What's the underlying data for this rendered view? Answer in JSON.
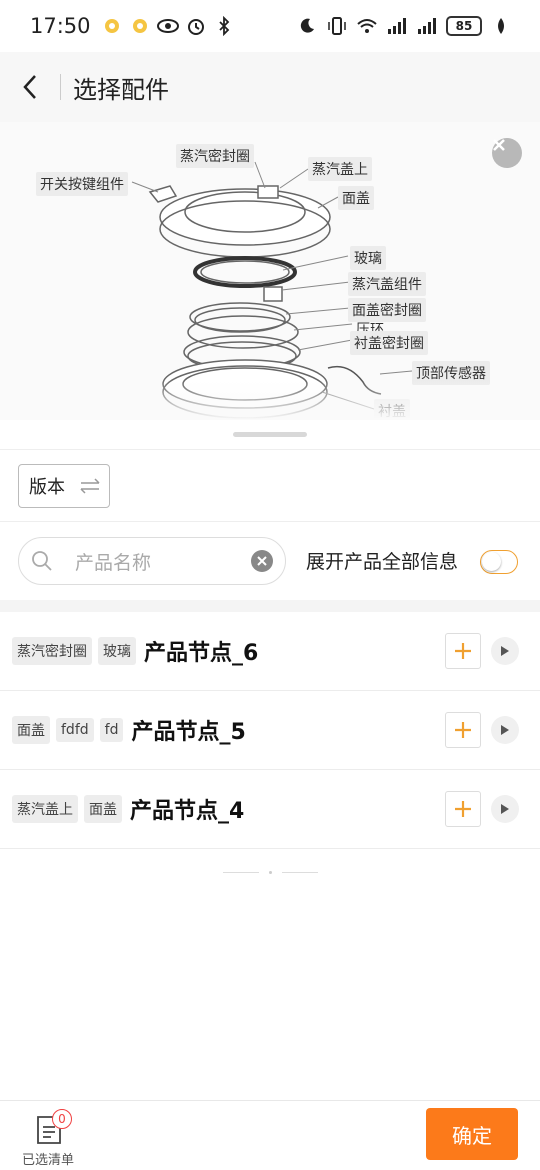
{
  "status_bar": {
    "time": "17:50",
    "battery": "85"
  },
  "header": {
    "title": "选择配件"
  },
  "diagram": {
    "callouts": [
      {
        "id": "steam-ring",
        "label": "蒸汽密封圈"
      },
      {
        "id": "switch-button",
        "label": "开关按键组件"
      },
      {
        "id": "steam-cover-top",
        "label": "蒸汽盖上"
      },
      {
        "id": "face-cover",
        "label": "面盖"
      },
      {
        "id": "glass",
        "label": "玻璃"
      },
      {
        "id": "steam-cover-assembly",
        "label": "蒸汽盖组件"
      },
      {
        "id": "face-cover-ring",
        "label": "面盖密封圈"
      },
      {
        "id": "pressure-ring",
        "label": "压环"
      },
      {
        "id": "liner-cover-ring",
        "label": "衬盖密封圈"
      },
      {
        "id": "top-sensor",
        "label": "顶部传感器"
      },
      {
        "id": "liner-cover",
        "label": "衬盖"
      }
    ]
  },
  "version": {
    "label": "版本"
  },
  "search": {
    "placeholder": "产品名称",
    "expand_label": "展开产品全部信息",
    "expand_on": false
  },
  "products": [
    {
      "tags": [
        "蒸汽密封圈",
        "玻璃"
      ],
      "name": "产品节点_6"
    },
    {
      "tags": [
        "面盖",
        "fdfd",
        "fd"
      ],
      "name": "产品节点_5"
    },
    {
      "tags": [
        "蒸汽盖上",
        "面盖"
      ],
      "name": "产品节点_4"
    }
  ],
  "bottom": {
    "cart_label": "已选清单",
    "cart_count": "0",
    "confirm_label": "确定"
  },
  "colors": {
    "accent": "#fc7a1a",
    "badge": "#f04040"
  }
}
